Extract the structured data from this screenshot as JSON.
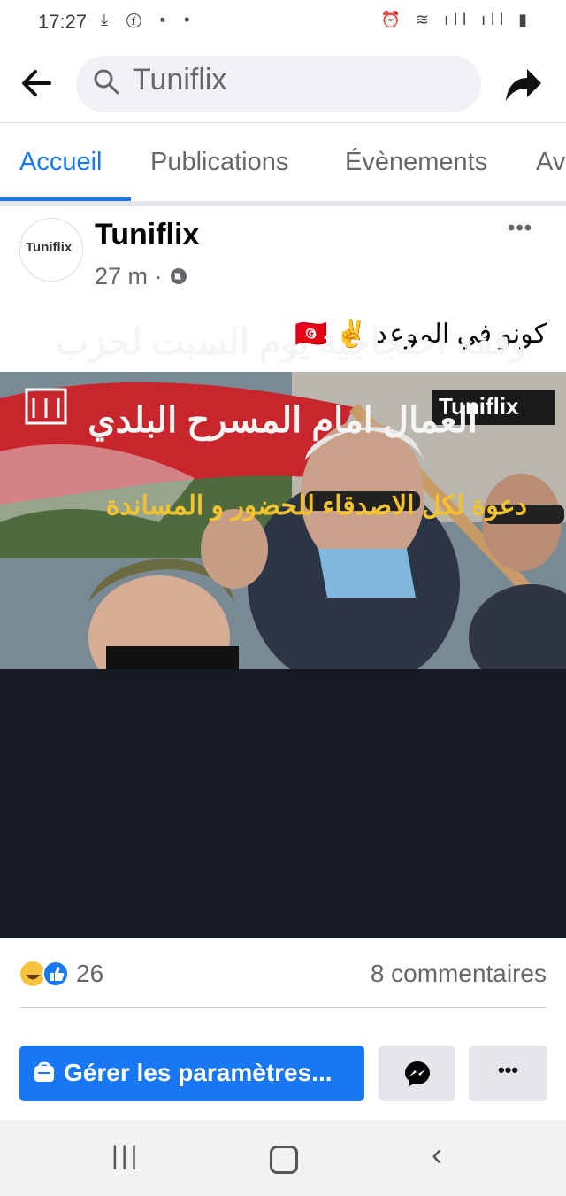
{
  "status_bar": {
    "time": "17:27",
    "left_icons": "⤓ ⓕ ▪ •",
    "right_icons": "⏰ ≋ ıll ıll ▮"
  },
  "search": {
    "value": "Tuniflix"
  },
  "tabs": [
    {
      "label": "Accueil",
      "active": true
    },
    {
      "label": "Publications",
      "active": false
    },
    {
      "label": "Évènements",
      "active": false
    },
    {
      "label": "Av",
      "active": false
    }
  ],
  "post": {
    "page_name": "Tuniflix",
    "time": "27 m",
    "separator": "·",
    "caption": "كونو في الموعد ✌️ 🇹🇳",
    "image": {
      "watermark": "Tuniflix",
      "line1": "وقفة احتجاجية يوم السبت لحزب",
      "line2": "العمال امام المسرح البلدي",
      "line3": "دعوة لكل الاصدقاء للحضور و المساندة"
    },
    "avatar_text": "Tuniflix",
    "reaction_count": "26",
    "comments": "8 commentaires"
  },
  "actions": {
    "manage_label": "Gérer les paramètres...",
    "more_label": "•••"
  },
  "colors": {
    "accent": "#1877f2",
    "banner": "#151a24",
    "highlight_text": "#f2c230"
  }
}
